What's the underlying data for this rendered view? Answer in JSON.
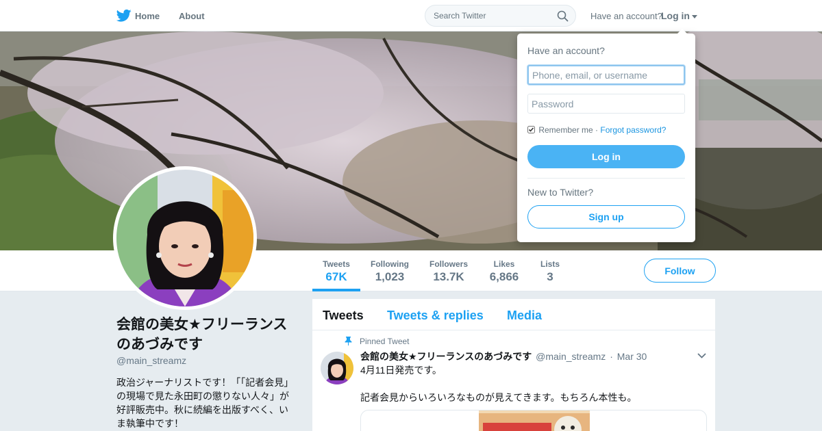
{
  "nav": {
    "home_label": "Home",
    "about_label": "About",
    "search_placeholder": "Search Twitter",
    "have_account": "Have an account?",
    "login_label": "Log in"
  },
  "profile": {
    "name": "会館の美女★フリーランスのあづみです",
    "handle": "@main_streamz",
    "bio": "政治ジャーナリストです！「「記者会見」の現場で見た永田町の懲りない人々」が好評販売中。秋に続編を出版すべく、いま執筆中です！"
  },
  "stats": [
    {
      "label": "Tweets",
      "value": "67K",
      "active": true
    },
    {
      "label": "Following",
      "value": "1,023"
    },
    {
      "label": "Followers",
      "value": "13.7K"
    },
    {
      "label": "Likes",
      "value": "6,866"
    },
    {
      "label": "Lists",
      "value": "3"
    }
  ],
  "follow_label": "Follow",
  "tabs": [
    {
      "label": "Tweets",
      "active": true
    },
    {
      "label": "Tweets & replies"
    },
    {
      "label": "Media"
    }
  ],
  "tweet": {
    "pinned_label": "Pinned Tweet",
    "name": "会館の美女★フリーランスのあづみです",
    "handle": "@main_streamz",
    "separator": "·",
    "date": "Mar 30",
    "line1": "4月11日発売です。",
    "line2": "記者会見からいろいろなものが見えてきます。もちろん本性も。"
  },
  "login_dropdown": {
    "title": "Have an account?",
    "username_placeholder": "Phone, email, or username",
    "password_placeholder": "Password",
    "remember_label": "Remember me",
    "separator": "·",
    "forgot_label": "Forgot password?",
    "login_button": "Log in",
    "new_label": "New to Twitter?",
    "signup_button": "Sign up"
  },
  "colors": {
    "accent": "#1da1f2",
    "login_button": "#4ab3f4",
    "background": "#e6ecf0"
  },
  "icons": [
    "twitter-bird-icon",
    "search-icon",
    "caret-down-icon",
    "pin-icon",
    "chevron-down-icon",
    "checkbox-icon"
  ]
}
